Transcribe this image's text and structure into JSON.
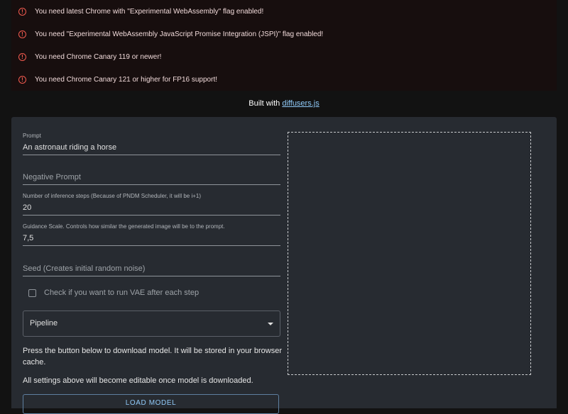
{
  "alerts": [
    "You need latest Chrome with \"Experimental WebAssembly\" flag enabled!",
    "You need \"Experimental WebAssembly JavaScript Promise Integration (JSPI)\" flag enabled!",
    "You need Chrome Canary 119 or newer!",
    "You need Chrome Canary 121 or higher for FP16 support!"
  ],
  "alert_icon": "!",
  "built_with": {
    "prefix": "Built with ",
    "link": "diffusers.js"
  },
  "form": {
    "prompt": {
      "label": "Prompt",
      "value": "An astronaut riding a horse"
    },
    "negative_prompt": {
      "placeholder": "Negative Prompt"
    },
    "steps": {
      "label": "Number of inference steps (Because of PNDM Scheduler, it will be i+1)",
      "value": "20"
    },
    "guidance": {
      "label": "Guidance Scale. Controls how similar the generated image will be to the prompt.",
      "value": "7,5"
    },
    "seed": {
      "placeholder": "Seed (Creates initial random noise)"
    },
    "vae_checkbox": {
      "label": "Check if you want to run VAE after each step",
      "checked": false
    },
    "pipeline": {
      "value": "Pipeline"
    }
  },
  "info": {
    "download": "Press the button below to download model. It will be stored in your browser cache.",
    "editable": "All settings above will become editable once model is downloaded."
  },
  "load_button": "LOAD MODEL",
  "colors": {
    "accent": "#90caf9",
    "error": "#f25a4f",
    "panel": "#272b31",
    "background": "#121212"
  }
}
